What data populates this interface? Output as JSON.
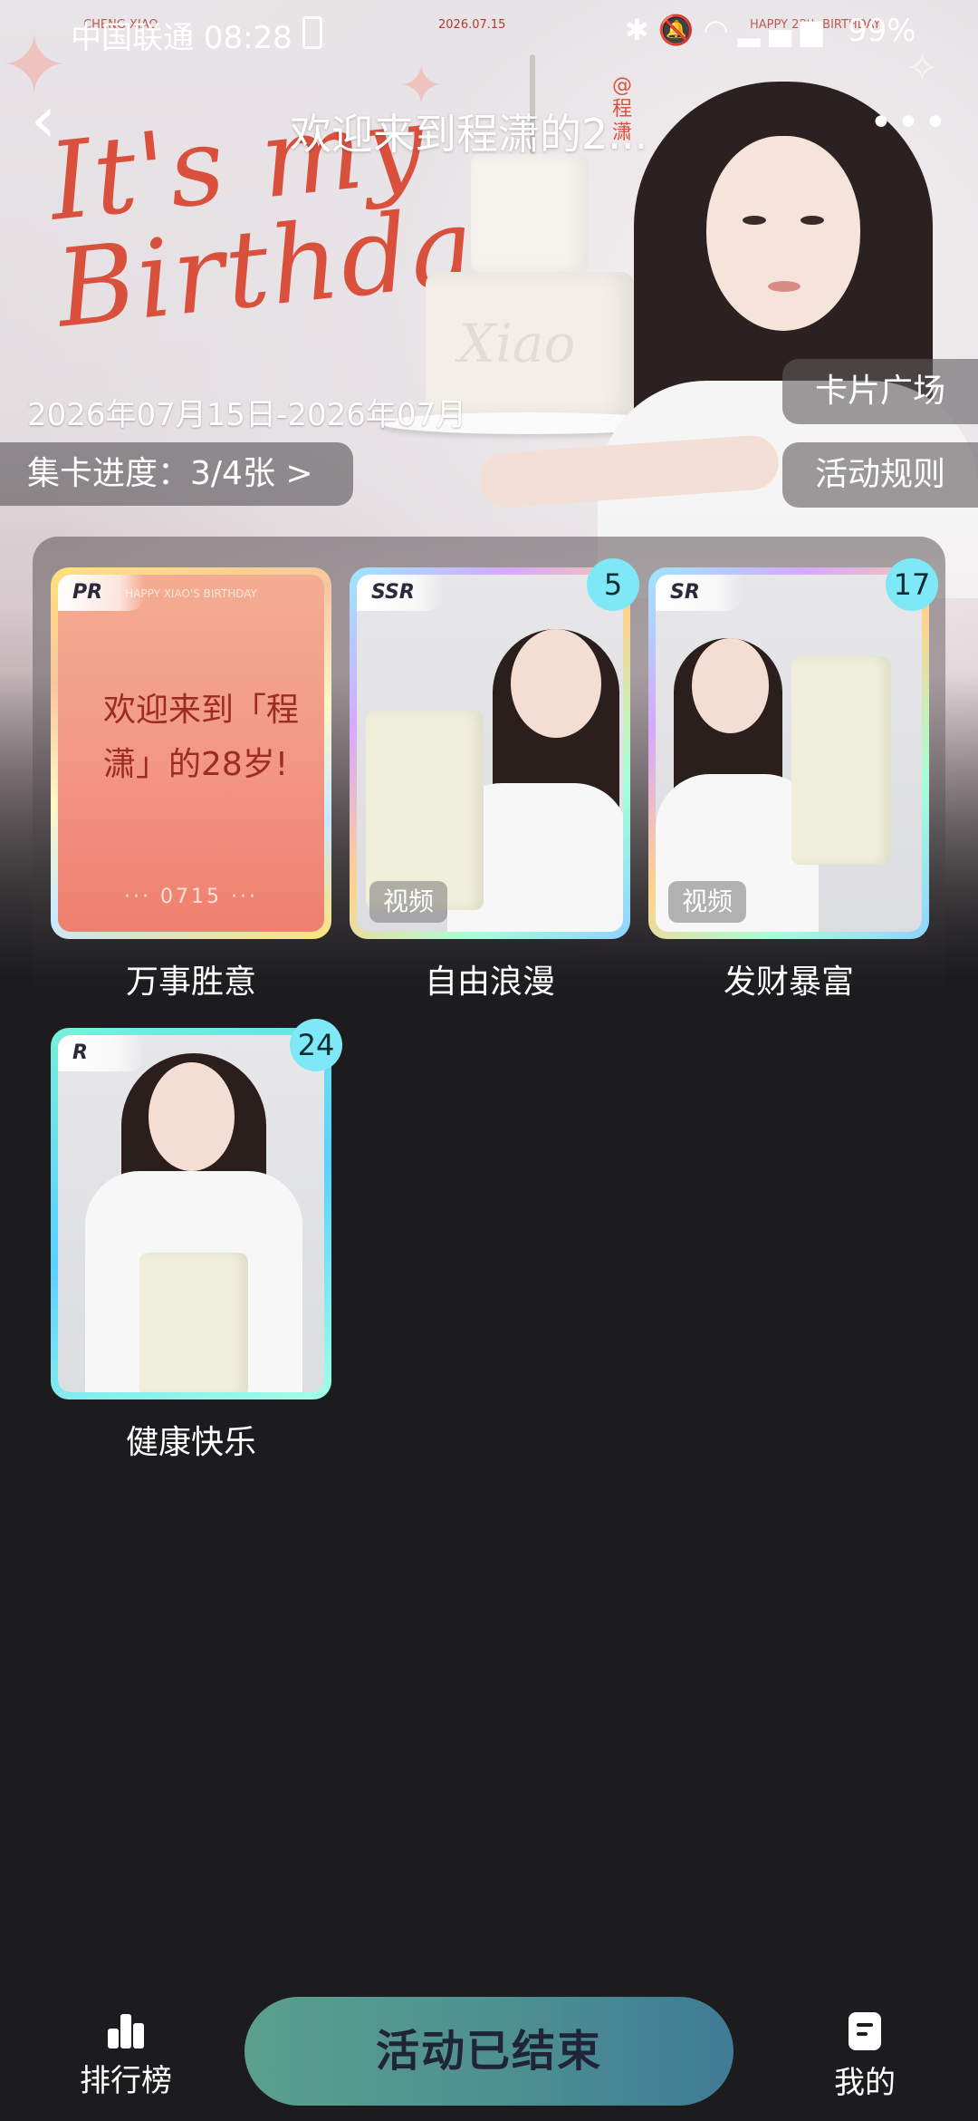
{
  "status_bar": {
    "carrier": "中国联通",
    "time": "08:28",
    "battery_pct": "99%"
  },
  "header": {
    "title": "欢迎来到程潇的2...",
    "back_icon": "chevron-left-icon",
    "more_icon": "more-dots-icon"
  },
  "banner": {
    "headline_line1": "It's my",
    "headline_line2": "Birthday!",
    "cake_script": "Xiao",
    "stamp_text": "@程潇",
    "print_date": "2026.07.15",
    "print_line": "HAPPY 28th BIRTHDAY",
    "print_line_left": "CHENG XIAO"
  },
  "activity": {
    "date_range": "2026年07月15日-2026年07月",
    "progress_text": "集卡进度：3/4张 >",
    "card_plaza_btn": "卡片广场",
    "rules_btn": "活动规则"
  },
  "cards": [
    {
      "rarity": "PR",
      "label": "万事胜意",
      "count": "",
      "video_tag": "",
      "art_text": "欢迎来到「程潇」的28岁!",
      "art_foot": "··· 0715 ···",
      "art_head": "HAPPY XIAO'S BIRTHDAY"
    },
    {
      "rarity": "SSR",
      "label": "自由浪漫",
      "count": "5",
      "video_tag": "视频"
    },
    {
      "rarity": "SR",
      "label": "发财暴富",
      "count": "17",
      "video_tag": "视频"
    },
    {
      "rarity": "R",
      "label": "健康快乐",
      "count": "24",
      "video_tag": ""
    }
  ],
  "bottom_bar": {
    "rank_label": "排行榜",
    "end_button": "活动已结束",
    "mine_label": "我的"
  }
}
